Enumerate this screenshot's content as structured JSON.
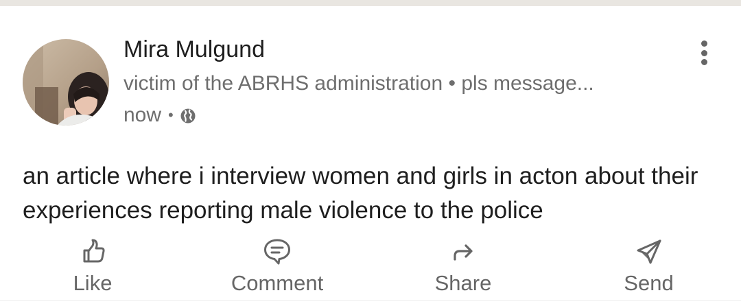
{
  "post": {
    "author_name": "Mira Mulgund",
    "author_headline": "victim of the ABRHS administration • pls message...",
    "timestamp": "now",
    "meta_separator": "•",
    "visibility_icon": "globe-icon",
    "text": "an article where i interview women and girls in acton about their experiences reporting male violence to the police"
  },
  "actions": {
    "like_label": "Like",
    "comment_label": "Comment",
    "share_label": "Share",
    "send_label": "Send"
  },
  "colors": {
    "text_primary": "#1e1e1e",
    "text_secondary": "#6e6e6e",
    "icon": "#666666",
    "top_strip": "#e9e6e1"
  }
}
